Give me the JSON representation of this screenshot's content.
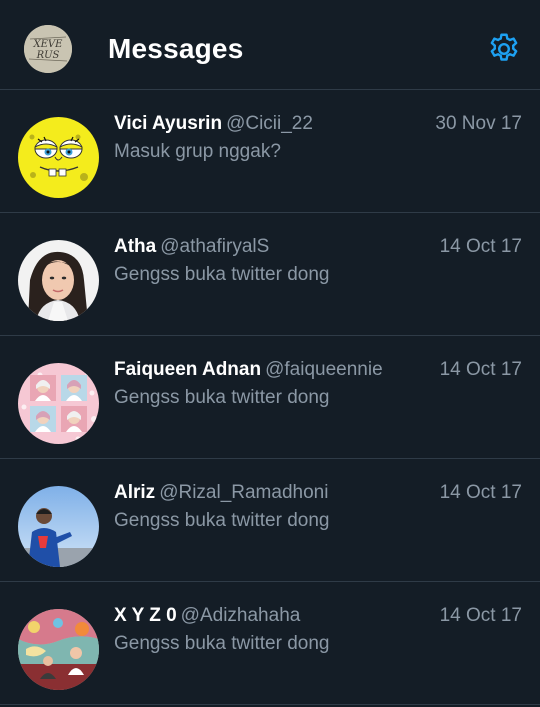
{
  "header": {
    "title": "Messages",
    "profile_avatar_text": "XEVE RUS"
  },
  "accent_color": "#1da1f2",
  "conversations": [
    {
      "name": "Vici Ayusrin",
      "handle": "@Cicii_22",
      "date": "30 Nov 17",
      "preview": "Masuk grup nggak?"
    },
    {
      "name": "Atha",
      "handle": "@athafiryalS",
      "date": "14 Oct 17",
      "preview": "Gengss buka twitter dong"
    },
    {
      "name": "Faiqueen Adnan",
      "handle": "@faiqueennie",
      "date": "14 Oct 17",
      "preview": "Gengss buka twitter dong"
    },
    {
      "name": "Alriz",
      "handle": "@Rizal_Ramadhoni",
      "date": "14 Oct 17",
      "preview": "Gengss buka twitter dong"
    },
    {
      "name": "X Y Z 0",
      "handle": "@Adizhahaha",
      "date": "14 Oct 17",
      "preview": "Gengss buka twitter dong"
    }
  ]
}
